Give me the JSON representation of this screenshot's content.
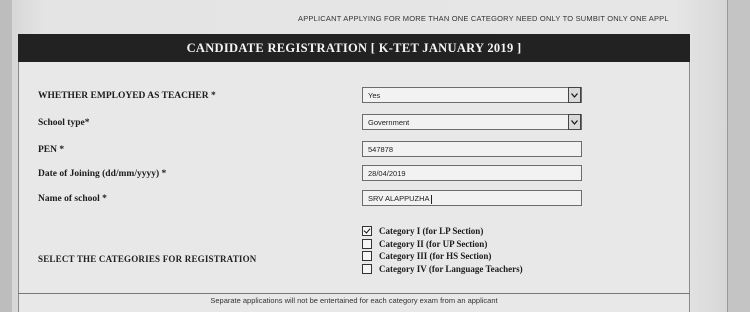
{
  "notice": "APPLICANT APPLYING FOR MORE THAN ONE CATEGORY NEED ONLY TO SUMBIT ONLY ONE APPL",
  "title": "CANDIDATE REGISTRATION [ K-TET JANUARY 2019 ]",
  "form": {
    "employed": {
      "label": "WHETHER EMPLOYED AS TEACHER *",
      "value": "Yes"
    },
    "school_type": {
      "label": "School type*",
      "value": "Government"
    },
    "pen": {
      "label": "PEN *",
      "value": "547878"
    },
    "doj": {
      "label": "Date of Joining (dd/mm/yyyy) *",
      "value": "28/04/2019"
    },
    "school_name": {
      "label": "Name of school *",
      "value": "SRV ALAPPUZHA"
    }
  },
  "categories": {
    "label": "SELECT THE CATEGORIES FOR REGISTRATION",
    "items": [
      {
        "label": "Category I (for LP Section)",
        "checked": true
      },
      {
        "label": "Category II (for UP Section)",
        "checked": false
      },
      {
        "label": "Category III (for HS Section)",
        "checked": false
      },
      {
        "label": "Category IV (for Language Teachers)",
        "checked": false
      }
    ]
  },
  "footer": "Separate applications will not be entertained for each category exam from an applicant"
}
